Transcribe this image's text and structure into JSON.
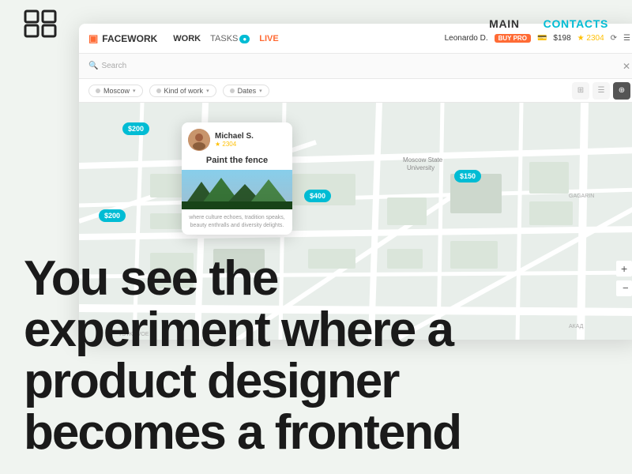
{
  "nav": {
    "logo_alt": "Portfolio Logo",
    "main_label": "MAIN",
    "contacts_label": "CONTACTS"
  },
  "app": {
    "brand": "FACEWORK",
    "nav_work": "WORK",
    "nav_tasks": "TASKS",
    "tasks_badge": "●",
    "nav_live": "LIVE",
    "user_name": "Leonardo D.",
    "pro_badge": "BUY PRO",
    "price": "$198",
    "stars_count": "2304",
    "search_placeholder": "Search",
    "filter_moscow": "Moscow",
    "filter_kind": "Kind of work",
    "filter_dates": "Dates",
    "price_bubble_1": "$200",
    "price_bubble_2": "$200",
    "price_bubble_3": "$400",
    "price_bubble_4": "$150",
    "card_name": "Michael S.",
    "card_rating": "2304",
    "card_job": "Paint the fence",
    "card_desc": "where culture echoes, tradition speaks, beauty enthralls and diversity delights."
  },
  "hero": {
    "title_line1": "You see the",
    "title_line2": "experiment where a",
    "title_line3": "product designer",
    "title_line4": "becomes a frontend"
  }
}
